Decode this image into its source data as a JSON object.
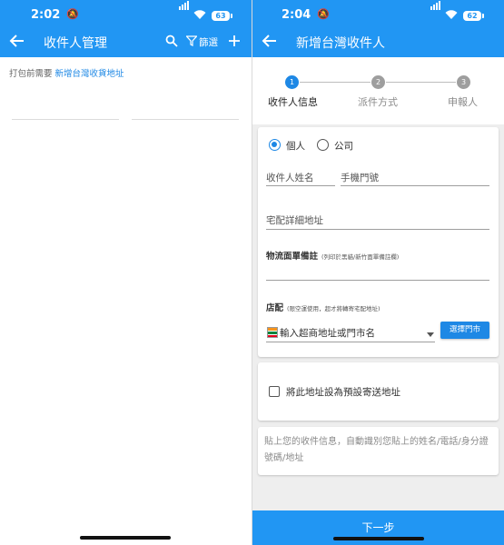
{
  "left_screen": {
    "status_bar": {
      "time": "2:02",
      "battery": "63"
    },
    "app_bar": {
      "title": "收件人管理",
      "filter_label": "篩選"
    },
    "hint": {
      "prefix": "打包前需要 ",
      "link": "新增台灣收貨地址"
    }
  },
  "right_screen": {
    "status_bar": {
      "time": "2:04",
      "battery": "62"
    },
    "app_bar": {
      "title": "新增台灣收件人"
    },
    "stepper": {
      "steps": [
        {
          "number": "1",
          "label": "收件人信息",
          "active": true
        },
        {
          "number": "2",
          "label": "派件方式",
          "active": false
        },
        {
          "number": "3",
          "label": "申報人",
          "active": false
        }
      ]
    },
    "form": {
      "type_options": [
        "個人",
        "公司"
      ],
      "selected_type": "個人",
      "name_label": "收件人姓名",
      "phone_label": "手機門號",
      "address_label": "宅配詳細地址",
      "note_label": "物流面單備註",
      "note_sub": "(列印於黑貓/新竹面單備註欄)",
      "store_label": "店配",
      "store_sub": "(限空運使用，超才將轉寄宅配地址)",
      "store_placeholder": "輸入超商地址或門市名",
      "select_store_button": "選擇門市"
    },
    "default_checkbox": {
      "label": "將此地址設為預設寄送地址",
      "checked": false
    },
    "paste_hint": "貼上您的收件信息，自動識別您貼上的姓名/電話/身分證號碼/地址",
    "next_button": "下一步"
  },
  "colors": {
    "primary": "#2196f3",
    "accent": "#1e88e5",
    "background": "#eeeeee"
  },
  "icons": [
    "back-arrow-icon",
    "search-icon",
    "filter-icon",
    "add-icon",
    "bell-mute-icon",
    "signal-icon",
    "wifi-icon",
    "battery-icon",
    "seven-eleven-logo",
    "dropdown-caret-icon"
  ]
}
